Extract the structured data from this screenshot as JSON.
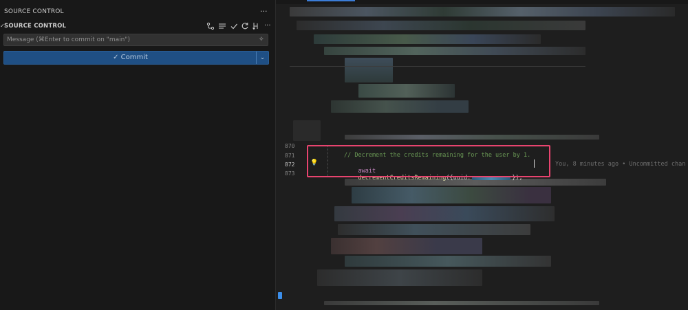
{
  "sidebar": {
    "header": "SOURCE CONTROL",
    "more": "···",
    "section_title": "SOURCE CONTROL",
    "toolbar_icons": [
      "graph-icon",
      "list-icon",
      "check-icon",
      "refresh-icon",
      "branch-icon",
      "more-icon"
    ],
    "message_placeholder": "Message (⌘Enter to commit on \"main\")",
    "commit_label": "Commit",
    "commit_check": "✓"
  },
  "editor": {
    "line_numbers": [
      "870",
      "871",
      "872",
      "873"
    ],
    "comment": "// Decrement the credits remaining for the user by 1.",
    "code_await": "await",
    "code_fn": "decrementCreditsRemaining",
    "code_args": "({uuid:",
    "code_tail": "});",
    "blame": "You, 8 minutes ago • Uncommitted chan"
  },
  "colors": {
    "accent": "#1f4f84",
    "highlight_border": "#e8446f"
  }
}
